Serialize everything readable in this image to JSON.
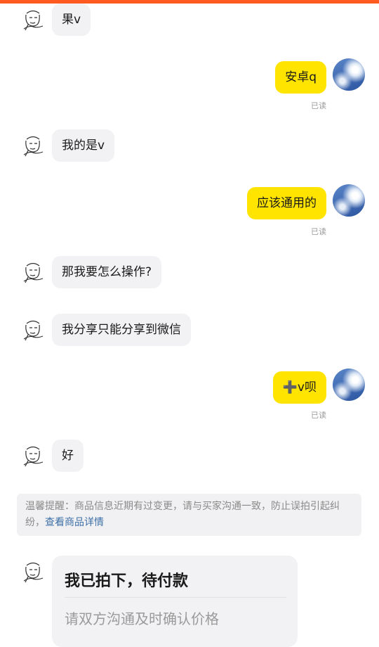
{
  "theme": {
    "accent": "#ff5a1f",
    "self_bubble": "#ffe400",
    "peer_bubble": "#f2f2f4",
    "link": "#3d6fa8"
  },
  "icons": {
    "peer_avatar": "sketch-face-avatar-icon",
    "self_avatar": "sky-clouds-avatar-icon"
  },
  "messages": [
    {
      "from": "peer",
      "text": "果v"
    },
    {
      "from": "self",
      "text": "安卓q",
      "status": "已读"
    },
    {
      "from": "peer",
      "text": "我的是v"
    },
    {
      "from": "self",
      "text": "应该通用的",
      "status": "已读"
    },
    {
      "from": "peer",
      "text": "那我要怎么操作?"
    },
    {
      "from": "peer",
      "text": "我分享只能分享到微信"
    },
    {
      "from": "self",
      "text": "➕v呗",
      "status": "已读"
    },
    {
      "from": "peer",
      "text": "好"
    }
  ],
  "notice": {
    "text": "温馨提醒：商品信息近期有过变更，请与买家沟通一致，防止误拍引起纠纷，",
    "link": "查看商品详情"
  },
  "order_card": {
    "title": "我已拍下，待付款",
    "subtitle": "请双方沟通及时确认价格"
  }
}
